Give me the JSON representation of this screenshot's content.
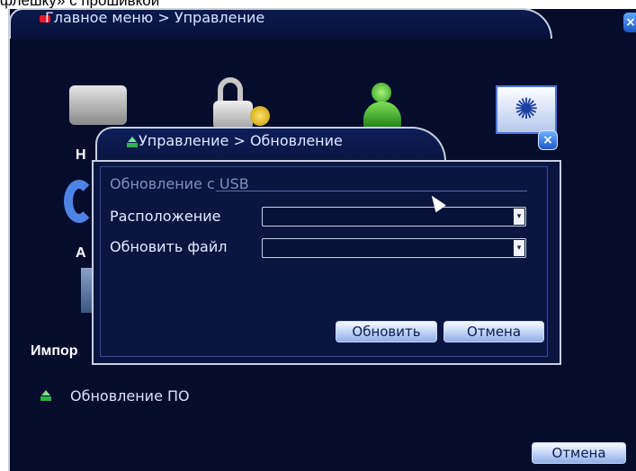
{
  "caption": "флешку» с прошивкой",
  "main_window": {
    "title": "Главное меню > Управление",
    "close_glyph": "×",
    "partial_labels": [
      "Н",
      "А",
      "Импор"
    ],
    "item_label": "Обновление ПО",
    "cancel_label": "Отмена",
    "icons": [
      "hdd-icon",
      "lock-key-icon",
      "user-icon",
      "gear-icon"
    ]
  },
  "dialog": {
    "title": "Управление > Обновление",
    "close_glyph": "×",
    "section_label": "Обновление с USB",
    "location_label": "Расположение",
    "location_value": "",
    "file_label": "Обновить файл",
    "file_value": "",
    "update_button": "Обновить",
    "cancel_button": "Отмена",
    "dropdown_glyph": "▾"
  },
  "colors": {
    "background": "#060d2c",
    "border": "#c8cfdc",
    "text": "#e4ecff",
    "section": "#7f8fbd",
    "button": "#b9cdf5",
    "title_icon_red": "#e01d2a",
    "user_green": "#2f9d1f"
  }
}
